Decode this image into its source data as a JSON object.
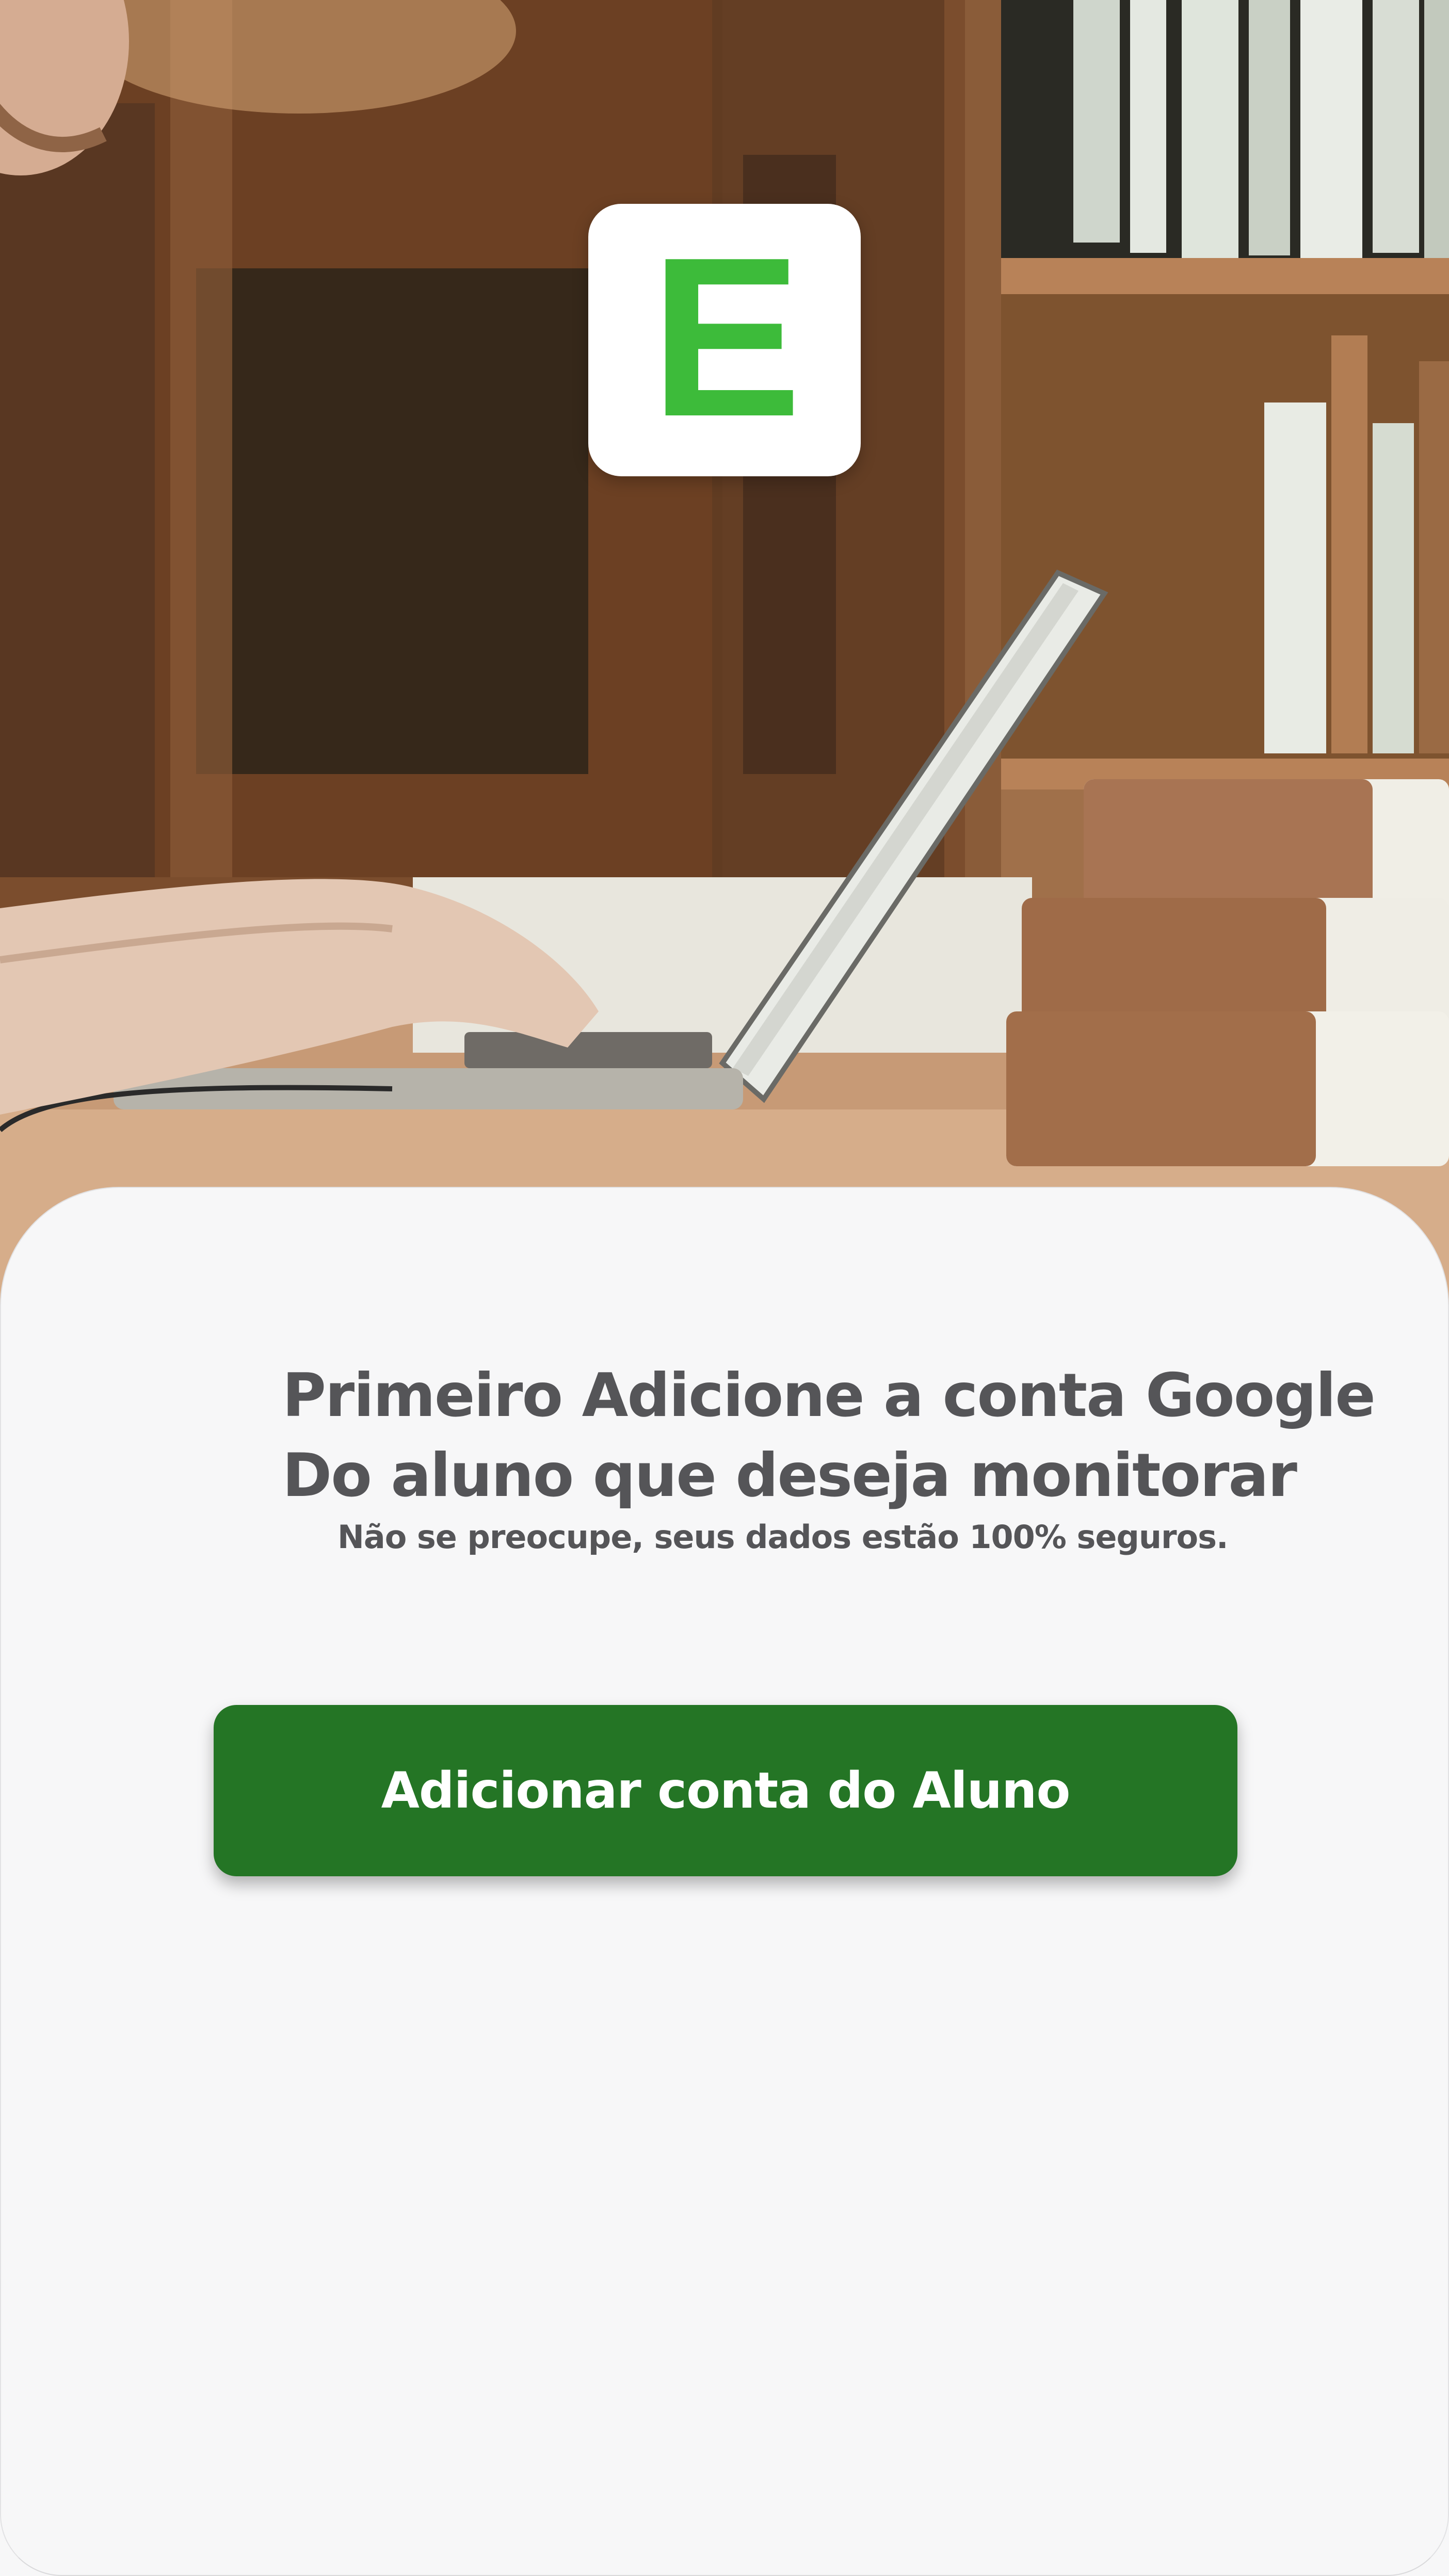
{
  "logo": {
    "letter": "E",
    "color": "#3dbb3a",
    "icon": "app-logo-icon"
  },
  "hero": {
    "image": "student-laptop-library-photo"
  },
  "card": {
    "headline_line1": "Primeiro Adicione a conta Google",
    "headline_line2": "Do aluno que deseja monitorar",
    "subline": "Não se preocupe, seus dados estão 100% seguros."
  },
  "actions": {
    "add_student_label": "Adicionar conta do Aluno",
    "button_color": "#247525"
  },
  "colors": {
    "background": "#f7f7f8",
    "text": "#555558",
    "accent": "#3dbb3a"
  }
}
